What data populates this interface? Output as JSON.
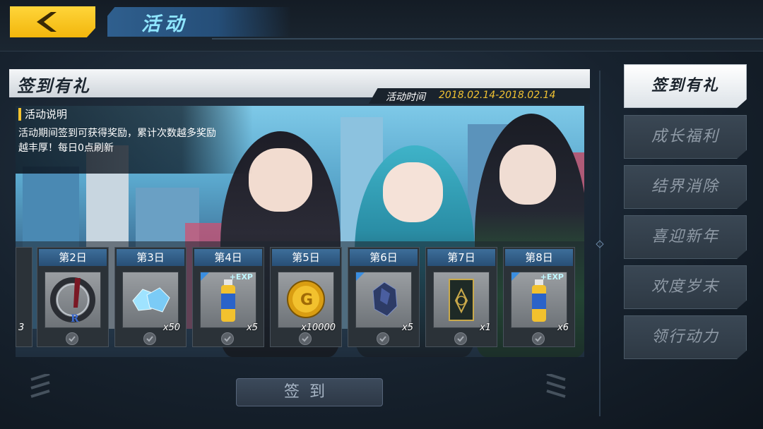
{
  "header": {
    "title": "活动",
    "back_icon": "chevron-left-icon",
    "accent_color": "#f5c218"
  },
  "panel": {
    "title": "签到有礼",
    "time_label": "活动时间",
    "time_value": "2018.02.14-2018.02.14",
    "info_heading": "活动说明",
    "info_line1": "活动期间签到可获得奖励，累计次数越多奖励",
    "info_line2": "越丰厚！每日0点刷新"
  },
  "rewards": {
    "partial_count": "3",
    "days": [
      {
        "label": "第2日",
        "item": "sword-ring-icon",
        "qty": ""
      },
      {
        "label": "第3日",
        "item": "crystal-icon",
        "qty": "x50"
      },
      {
        "label": "第4日",
        "item": "exp-drink-icon",
        "qty": "x5",
        "tag": "+EXP"
      },
      {
        "label": "第5日",
        "item": "gold-coin-icon",
        "qty": "x10000"
      },
      {
        "label": "第6日",
        "item": "dark-ore-icon",
        "qty": "x5"
      },
      {
        "label": "第7日",
        "item": "tarot-card-icon",
        "qty": "x1"
      },
      {
        "label": "第8日",
        "item": "exp-drink-icon",
        "qty": "x6",
        "tag": "+EXP"
      }
    ]
  },
  "sign_button": "签到",
  "nav": [
    {
      "label": "签到有礼",
      "active": true
    },
    {
      "label": "成长福利",
      "active": false
    },
    {
      "label": "结界消除",
      "active": false
    },
    {
      "label": "喜迎新年",
      "active": false
    },
    {
      "label": "欢度岁末",
      "active": false
    },
    {
      "label": "领行动力",
      "active": false
    }
  ]
}
